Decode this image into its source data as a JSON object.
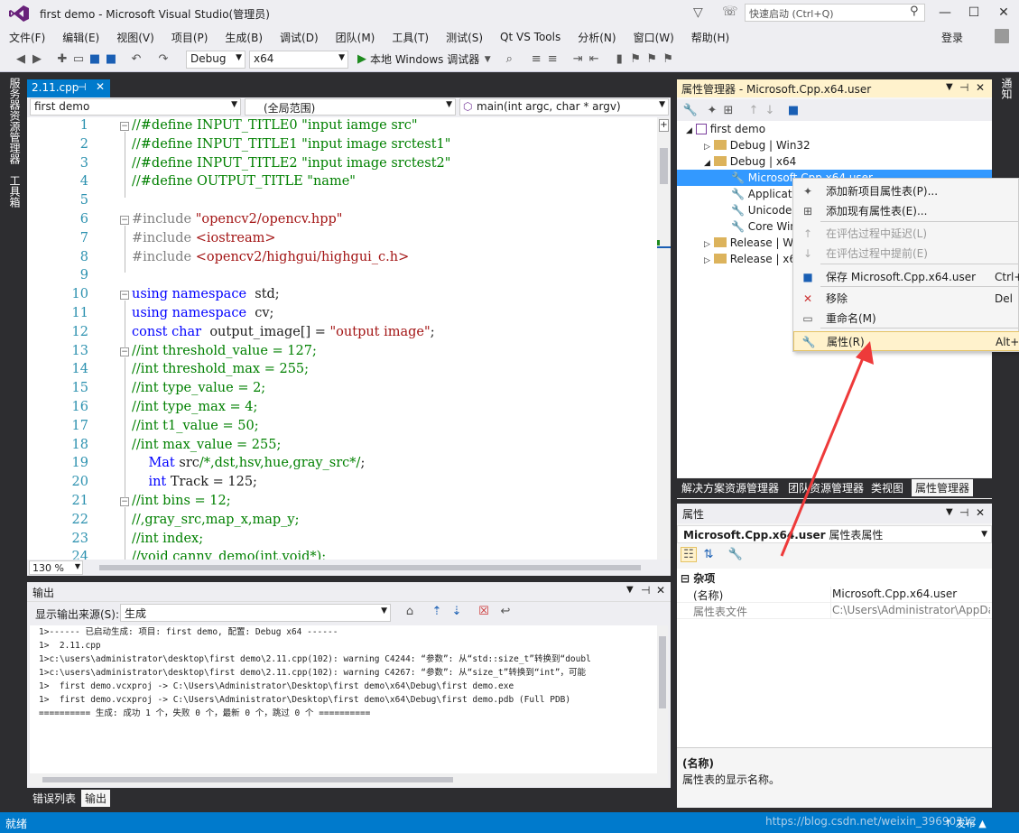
{
  "window": {
    "title": "first demo - Microsoft Visual Studio(管理员)",
    "quick_launch_placeholder": "快速启动 (Ctrl+Q)"
  },
  "menu": [
    "文件(F)",
    "编辑(E)",
    "视图(V)",
    "项目(P)",
    "生成(B)",
    "调试(D)",
    "团队(M)",
    "工具(T)",
    "测试(S)",
    "Qt VS Tools",
    "分析(N)",
    "窗口(W)",
    "帮助(H)"
  ],
  "login": "登录",
  "toolbar": {
    "config": "Debug",
    "platform": "x64",
    "run_label": "本地 Windows 调试器"
  },
  "left_strip": {
    "tab1": "服务器资源管理器",
    "tab2": "工具箱"
  },
  "right_strip": {
    "tab1": "通知"
  },
  "editor": {
    "tab_name": "2.11.cpp",
    "nav_project": "first demo",
    "nav_scope": "(全局范围)",
    "nav_function": "main(int argc, char * argv)",
    "zoom": "130 %",
    "lines": [
      {
        "n": "1",
        "tokens": [
          [
            "cm",
            "//#define INPUT_TITLE0 \"input iamge src\""
          ]
        ]
      },
      {
        "n": "2",
        "tokens": [
          [
            "cm",
            "//#define INPUT_TITLE1 \"input image srctest1\""
          ]
        ]
      },
      {
        "n": "3",
        "tokens": [
          [
            "cm",
            "//#define INPUT_TITLE2 \"input image srctest2\""
          ]
        ]
      },
      {
        "n": "4",
        "tokens": [
          [
            "cm",
            "//#define OUTPUT_TITLE \"name\""
          ]
        ]
      },
      {
        "n": "5",
        "tokens": []
      },
      {
        "n": "6",
        "tokens": [
          [
            "pp",
            "#include "
          ],
          [
            "st",
            "\"opencv2/opencv.hpp\""
          ]
        ]
      },
      {
        "n": "7",
        "tokens": [
          [
            "pp",
            "#include "
          ],
          [
            "st",
            "<iostream>"
          ]
        ]
      },
      {
        "n": "8",
        "tokens": [
          [
            "pp",
            "#include "
          ],
          [
            "st",
            "<opencv2/highgui/highgui_c.h>"
          ]
        ]
      },
      {
        "n": "9",
        "tokens": []
      },
      {
        "n": "10",
        "tokens": [
          [
            "kw",
            "using namespace"
          ],
          [
            "",
            "  std;"
          ]
        ]
      },
      {
        "n": "11",
        "tokens": [
          [
            "kw",
            "using namespace"
          ],
          [
            "",
            "  cv;"
          ]
        ]
      },
      {
        "n": "12",
        "tokens": [
          [
            "kw",
            "const char"
          ],
          [
            "",
            "  output_image[] = "
          ],
          [
            "st",
            "\"output image\""
          ],
          [
            "",
            ";"
          ]
        ]
      },
      {
        "n": "13",
        "tokens": [
          [
            "cm",
            "//int threshold_value = 127;"
          ]
        ]
      },
      {
        "n": "14",
        "tokens": [
          [
            "cm",
            "//int threshold_max = 255;"
          ]
        ]
      },
      {
        "n": "15",
        "tokens": [
          [
            "cm",
            "//int type_value = 2;"
          ]
        ]
      },
      {
        "n": "16",
        "tokens": [
          [
            "cm",
            "//int type_max = 4;"
          ]
        ]
      },
      {
        "n": "17",
        "tokens": [
          [
            "cm",
            "//int t1_value = 50;"
          ]
        ]
      },
      {
        "n": "18",
        "tokens": [
          [
            "cm",
            "//int max_value = 255;"
          ]
        ]
      },
      {
        "n": "19",
        "tokens": [
          [
            "",
            "    "
          ],
          [
            "kw",
            "Mat"
          ],
          [
            "",
            " src"
          ],
          [
            "cm",
            "/*,dst,hsv,hue,gray_src*/"
          ],
          [
            "",
            ";"
          ]
        ]
      },
      {
        "n": "20",
        "tokens": [
          [
            "",
            "    "
          ],
          [
            "kw",
            "int"
          ],
          [
            "",
            " Track = 125;"
          ]
        ]
      },
      {
        "n": "21",
        "tokens": [
          [
            "cm",
            "//int bins = 12;"
          ]
        ]
      },
      {
        "n": "22",
        "tokens": [
          [
            "cm",
            "//,gray_src,map_x,map_y;"
          ]
        ]
      },
      {
        "n": "23",
        "tokens": [
          [
            "cm",
            "//int index;"
          ]
        ]
      },
      {
        "n": "24",
        "tokens": [
          [
            "cm",
            "//void canny_demo(int,void*);"
          ]
        ]
      }
    ]
  },
  "output": {
    "title": "输出",
    "source_label": "显示输出来源(S):",
    "source_value": "生成",
    "lines": [
      "1>------ 已启动生成: 项目: first demo, 配置: Debug x64 ------",
      "1>  2.11.cpp",
      "1>c:\\users\\administrator\\desktop\\first demo\\2.11.cpp(102): warning C4244: “参数”: 从“std::size_t”转换到“doubl",
      "1>c:\\users\\administrator\\desktop\\first demo\\2.11.cpp(102): warning C4267: “参数”: 从“size_t”转换到“int”，可能",
      "1>  first demo.vcxproj -> C:\\Users\\Administrator\\Desktop\\first demo\\x64\\Debug\\first demo.exe",
      "1>  first demo.vcxproj -> C:\\Users\\Administrator\\Desktop\\first demo\\x64\\Debug\\first demo.pdb (Full PDB)",
      "========== 生成: 成功 1 个，失败 0 个，最新 0 个，跳过 0 个 =========="
    ],
    "tabs": [
      "错误列表",
      "输出"
    ]
  },
  "property_manager": {
    "title": "属性管理器 - Microsoft.Cpp.x64.user",
    "tree": {
      "root": "first demo",
      "debug_win32": "Debug | Win32",
      "debug_x64": "Debug | x64",
      "items": [
        "Microsoft.Cpp.x64.user",
        "Applicati",
        "Unicode",
        "Core Win"
      ],
      "release_win32": "Release | Win",
      "release_x64": "Release | x64"
    },
    "tabs": [
      "解决方案资源管理器",
      "团队资源管理器",
      "类视图",
      "属性管理器"
    ]
  },
  "context_menu": [
    {
      "label": "添加新项目属性表(P)...",
      "shortcut": "",
      "enabled": true
    },
    {
      "label": "添加现有属性表(E)...",
      "shortcut": "",
      "enabled": true
    },
    {
      "label": "在评估过程中延迟(L)",
      "shortcut": "",
      "enabled": false
    },
    {
      "label": "在评估过程中提前(E)",
      "shortcut": "",
      "enabled": false
    },
    {
      "label": "保存 Microsoft.Cpp.x64.user",
      "shortcut": "Ctrl+",
      "enabled": true
    },
    {
      "label": "移除",
      "shortcut": "Del",
      "enabled": true
    },
    {
      "label": "重命名(M)",
      "shortcut": "",
      "enabled": true
    },
    {
      "label": "属性(R)",
      "shortcut": "Alt+E",
      "enabled": true
    }
  ],
  "properties": {
    "title": "属性",
    "object_name": "Microsoft.Cpp.x64.user",
    "object_type": "属性表属性",
    "category": "杂项",
    "rows": [
      {
        "name": "(名称)",
        "value": "Microsoft.Cpp.x64.user"
      },
      {
        "name": "属性表文件",
        "value": "C:\\Users\\Administrator\\AppData\\"
      }
    ],
    "desc_title": "(名称)",
    "desc_text": "属性表的显示名称。"
  },
  "status": {
    "text": "就绪",
    "publish": "↑ 发布 ▲",
    "watermark": "https://blog.csdn.net/weixin_39690312"
  },
  "colors": {
    "accent": "#007acc",
    "selection": "#cce8ff",
    "arrow": "#ee3a3a"
  }
}
